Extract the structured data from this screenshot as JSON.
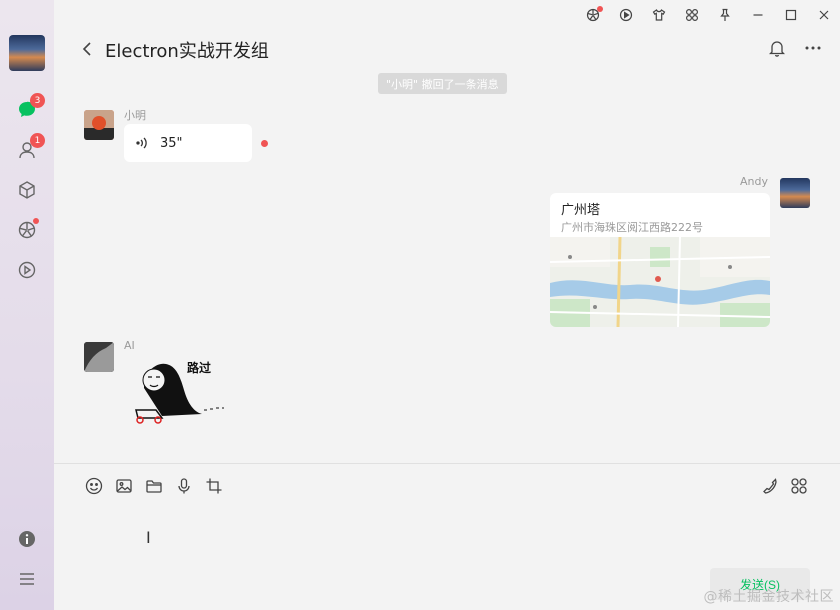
{
  "sidebar": {
    "message_badge": "3",
    "contacts_badge": "1"
  },
  "header": {
    "title": "Electron实战开发组"
  },
  "system_notice": "\"小明\" 撤回了一条消息",
  "messages": [
    {
      "sender": "小明",
      "voice_duration": "35\""
    },
    {
      "sender": "Andy",
      "location_title": "广州塔",
      "location_address": "广州市海珠区阅江西路222号"
    },
    {
      "sender": "AI",
      "sticker_caption": "路过"
    }
  ],
  "composer": {
    "send_label": "发送(S)"
  },
  "watermark": "@稀土掘金技术社区",
  "colors": {
    "accent_green": "#07c160",
    "badge_red": "#f05454",
    "chat_bg": "#f3f3f3"
  }
}
